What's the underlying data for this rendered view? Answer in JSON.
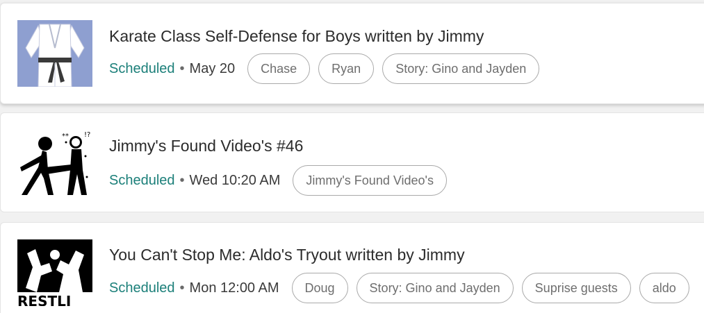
{
  "items": [
    {
      "title": "Karate Class Self-Defense for Boys written by Jimmy",
      "status": "Scheduled",
      "separator": "•",
      "date": "May 20",
      "tags": [
        "Chase",
        "Ryan",
        "Story: Gino and Jayden"
      ],
      "thumb_icon": "karate-gi-icon"
    },
    {
      "title": "Jimmy's Found Video's #46",
      "status": "Scheduled",
      "separator": "•",
      "date": "Wed 10:20 AM",
      "tags": [
        "Jimmy's Found Video's"
      ],
      "thumb_icon": "kick-fight-icon"
    },
    {
      "title": "You Can't Stop Me: Aldo's Tryout written by Jimmy",
      "status": "Scheduled",
      "separator": "•",
      "date": "Mon 12:00 AM",
      "tags": [
        "Doug",
        "Story: Gino and Jayden",
        "Suprise guests",
        "aldo"
      ],
      "thumb_icon": "wrestling-icon",
      "thumb_text": "RESTLI"
    }
  ],
  "colors": {
    "status": "#1b7f79",
    "chip_border": "#a9a9a9",
    "title": "#2b2b2b"
  }
}
